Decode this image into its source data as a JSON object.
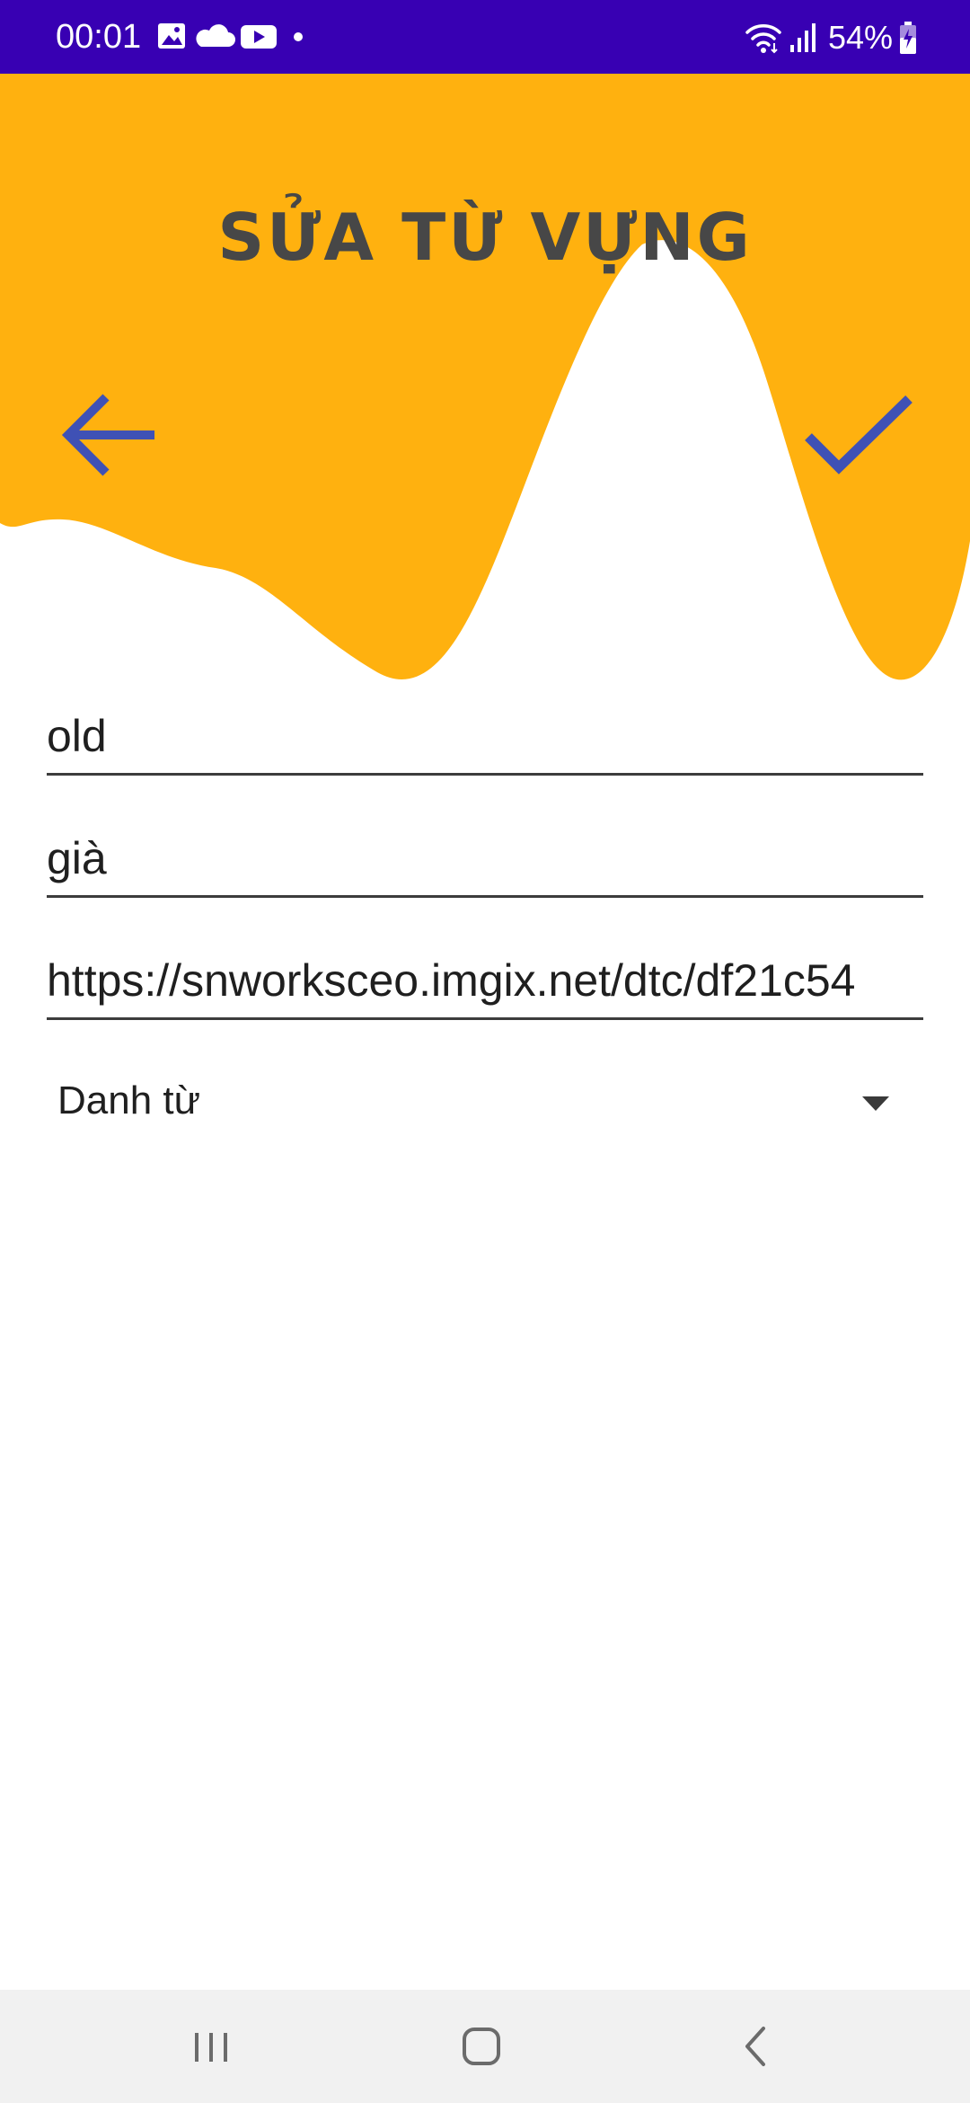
{
  "status_bar": {
    "time": "00:01",
    "battery": "54%",
    "icons_left": [
      "image-icon",
      "cloud-icon",
      "youtube-icon",
      "dot-icon"
    ],
    "icons_right": [
      "wifi-icon",
      "signal-icon",
      "battery-icon"
    ],
    "background_color": "#3800b3"
  },
  "header": {
    "title": "SỬA TỪ VỰNG",
    "accent_color": "#ffb10f",
    "icon_color": "#3f51b5"
  },
  "form": {
    "word_value": "old",
    "meaning_value": "già",
    "image_url_value": "https://snworksceo.imgix.net/dtc/df21c54",
    "word_type_selected": "Danh từ"
  },
  "nav_bar": {
    "buttons": [
      "recents-icon",
      "home-icon",
      "back-icon"
    ]
  }
}
